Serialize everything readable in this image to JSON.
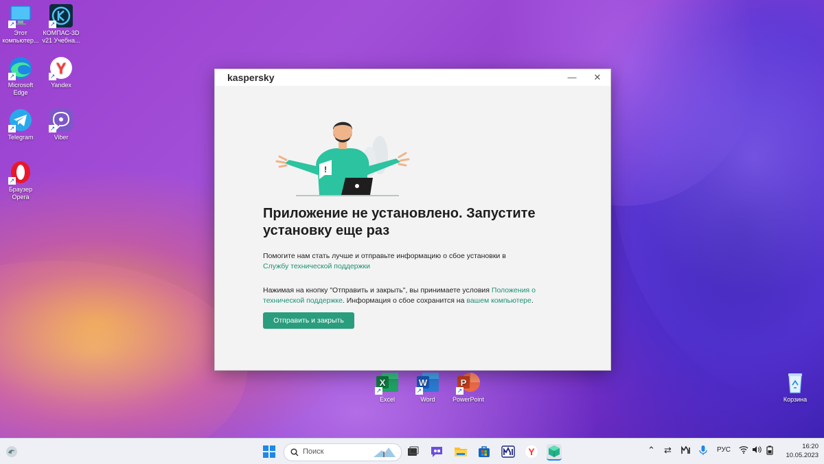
{
  "desktop_icons": [
    {
      "label": "Этот компьютер...",
      "icon": "computer-icon"
    },
    {
      "label": "КОМПАС-3D v21 Учебна...",
      "icon": "kompas-icon"
    },
    {
      "label": "Microsoft Edge",
      "icon": "edge-icon"
    },
    {
      "label": "Yandex",
      "icon": "yandex-icon"
    },
    {
      "label": "Telegram",
      "icon": "telegram-icon"
    },
    {
      "label": "Viber",
      "icon": "viber-icon"
    },
    {
      "label": "Браузер Opera",
      "icon": "opera-icon"
    },
    {
      "label": "Excel",
      "icon": "excel-icon"
    },
    {
      "label": "Word",
      "icon": "word-icon"
    },
    {
      "label": "PowerPoint",
      "icon": "powerpoint-icon"
    },
    {
      "label": "Корзина",
      "icon": "recycle-bin-icon"
    }
  ],
  "window": {
    "brand": "kaspersky",
    "minimize": "—",
    "close": "✕",
    "headline": "Приложение не установлено. Запустите установку еще раз",
    "help_text": "Помогите нам стать лучше и отправьте информацию о сбое установки в",
    "help_link": "Службу технической поддержки",
    "terms_text_1": "Нажимая на кнопку \"Отправить и закрыть\", вы принимаете условия",
    "terms_link": "Положения о технической поддержке",
    "terms_text_2": ". Информация о сбое сохранится на",
    "terms_link_2": "вашем компьютере",
    "terms_text_3": ".",
    "button": "Отправить и закрыть",
    "accent": "#2a9d7e"
  },
  "taskbar": {
    "search_placeholder": "Поиск",
    "language": "РУС",
    "time": "16:20",
    "date": "10.05.2023"
  }
}
